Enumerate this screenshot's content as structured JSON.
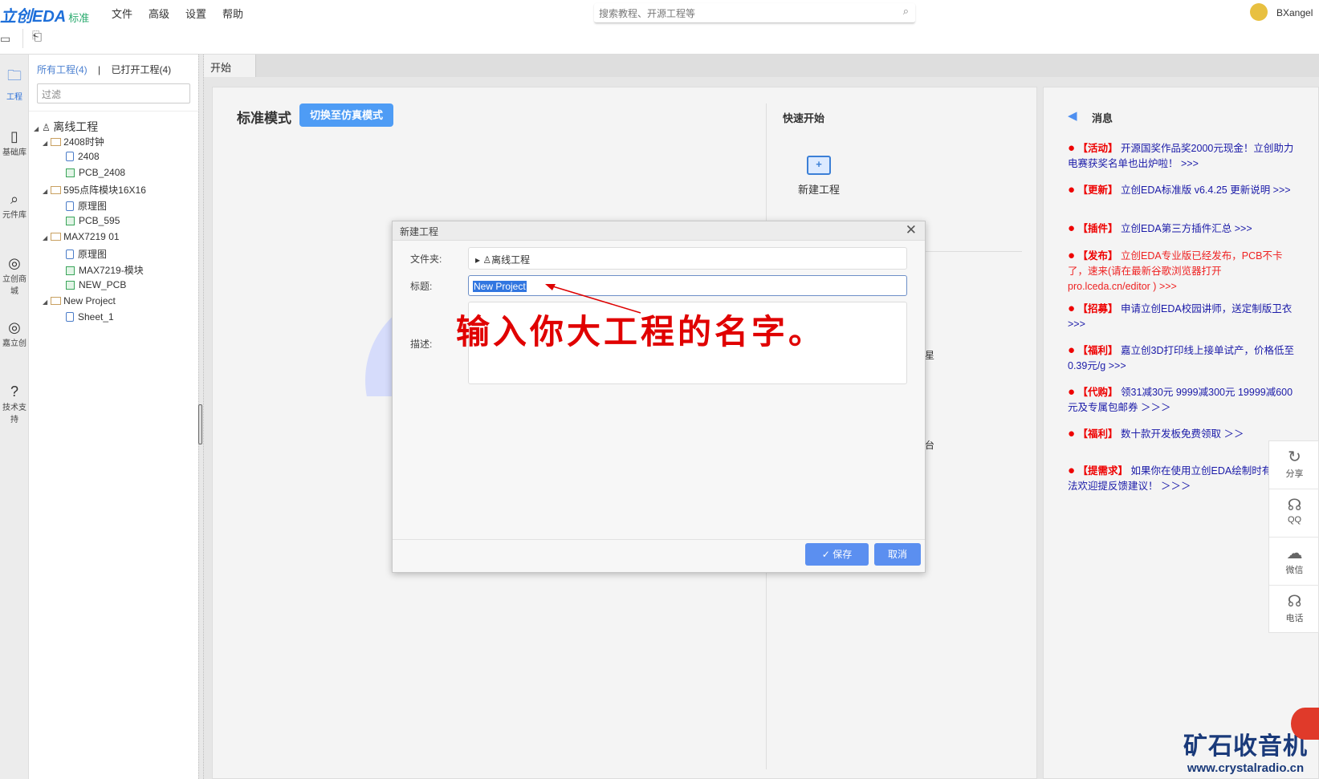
{
  "app": {
    "logo": "立创EDA",
    "edition": "标准",
    "menu": [
      "文件",
      "高级",
      "设置",
      "帮助"
    ],
    "search_placeholder": "搜索教程、开源工程等",
    "user": "BXangel"
  },
  "left_icons": [
    {
      "label": "工程"
    },
    {
      "label": "基础库"
    },
    {
      "label": "元件库"
    },
    {
      "label": "立创商城"
    },
    {
      "label": "嘉立创"
    },
    {
      "label": "技术支持"
    }
  ],
  "project_panel": {
    "tab_all": "所有工程(4)",
    "separator": "|",
    "tab_open": "已打开工程(4)",
    "filter_placeholder": "过滤",
    "tree": [
      {
        "label": "离线工程",
        "type": "root",
        "level": 0
      },
      {
        "label": "2408时钟",
        "type": "folder",
        "level": 1
      },
      {
        "label": "2408",
        "type": "sch",
        "level": 2
      },
      {
        "label": "PCB_2408",
        "type": "pcb",
        "level": 2
      },
      {
        "label": "595点阵模块16X16",
        "type": "folder",
        "level": 1
      },
      {
        "label": "原理图",
        "type": "sch",
        "level": 2
      },
      {
        "label": "PCB_595",
        "type": "pcb",
        "level": 2
      },
      {
        "label": "MAX7219 01",
        "type": "folder",
        "level": 1
      },
      {
        "label": "原理图",
        "type": "sch",
        "level": 2
      },
      {
        "label": "MAX7219-模块",
        "type": "pcb",
        "level": 2
      },
      {
        "label": "NEW_PCB",
        "type": "pcb",
        "level": 2
      },
      {
        "label": "New Project",
        "type": "folder",
        "level": 1
      },
      {
        "label": "Sheet_1",
        "type": "sch",
        "level": 2
      }
    ]
  },
  "tab": {
    "label": "开始"
  },
  "start": {
    "mode_title": "标准模式",
    "mode_button": "切换至仿真模式",
    "quick_start": "快速开始",
    "new_project": "新建工程",
    "partial_1": "星",
    "partial_2": "台"
  },
  "messages": {
    "title": "消息",
    "items": [
      {
        "tag": "【活动】",
        "text": "开源国奖作品奖2000元现金！立创助力电赛获奖名单也出炉啦！ >>>",
        "red": false
      },
      {
        "tag": "【更新】",
        "text": "立创EDA标准版 v6.4.25 更新说明 >>>",
        "red": false
      },
      {
        "tag": "【插件】",
        "text": "立创EDA第三方插件汇总 >>>",
        "red": false
      },
      {
        "tag": "【发布】",
        "text": "立创EDA专业版已经发布，PCB不卡了，速来(请在最新谷歌浏览器打开 pro.lceda.cn/editor ) >>>",
        "red": true
      },
      {
        "tag": "【招募】",
        "text": "申请立创EDA校园讲师，送定制版卫衣 >>>",
        "red": false
      },
      {
        "tag": "【福利】",
        "text": "嘉立创3D打印线上接单试产，价格低至0.39元/g >>>",
        "red": false
      },
      {
        "tag": "【代购】",
        "text": "领31减30元 9999减300元 19999减600元及专属包邮券 ＞＞＞",
        "red": false
      },
      {
        "tag": "【福利】",
        "text": "数十款开发板免费领取 ＞＞",
        "red": false
      },
      {
        "tag": "【提需求】",
        "text": "如果你在使用立创EDA绘制时有任何想法欢迎提反馈建议！ ＞＞＞",
        "red": false
      }
    ]
  },
  "social": [
    {
      "label": "分享",
      "icon": "share-icon"
    },
    {
      "label": "QQ",
      "icon": "qq-icon"
    },
    {
      "label": "微信",
      "icon": "wechat-icon"
    },
    {
      "label": "电话",
      "icon": "headset-icon"
    }
  ],
  "dialog": {
    "title": "新建工程",
    "folder_label": "文件夹:",
    "folder_value": "离线工程",
    "title_label": "标题:",
    "title_value": "New Project",
    "desc_label": "描述:",
    "save": "保存",
    "cancel": "取消"
  },
  "annotation": "输入你大工程的名字。",
  "watermark": {
    "name": "矿石收音机",
    "url": "www.crystalradio.cn"
  },
  "colors": {
    "accent": "#4e9cf5",
    "annotation": "#e00000"
  }
}
